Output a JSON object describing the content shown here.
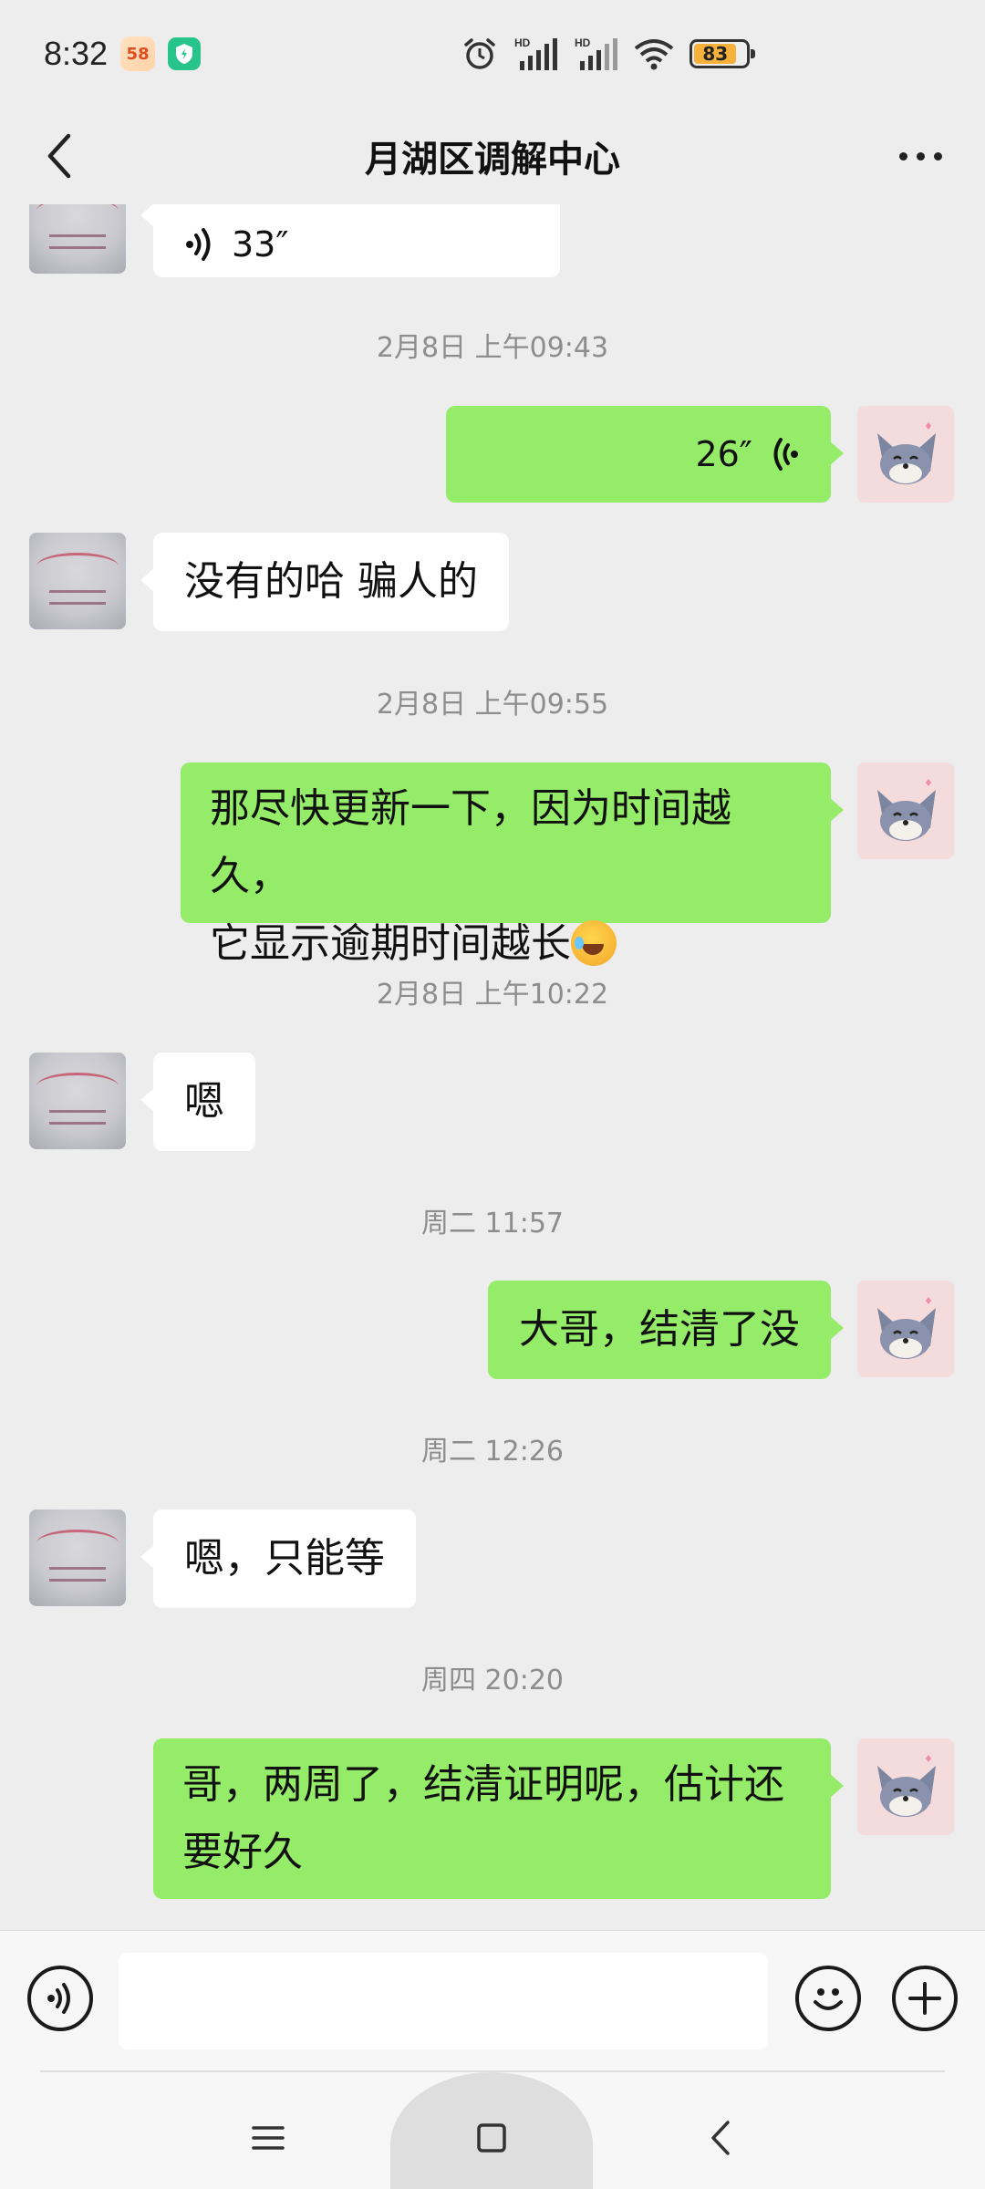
{
  "status_bar": {
    "time": "8:32",
    "app_badge_58": "58",
    "signal_1_label": "HD",
    "signal_2_label": "HD",
    "battery_level": "83"
  },
  "header": {
    "title": "月湖区调解中心"
  },
  "messages": [
    {
      "type": "voice",
      "direction": "in",
      "duration": "33″"
    },
    {
      "type": "timestamp",
      "text": "2月8日 上午09:43"
    },
    {
      "type": "voice",
      "direction": "out",
      "duration": "26″"
    },
    {
      "type": "text",
      "direction": "in",
      "text": "没有的哈 骗人的"
    },
    {
      "type": "timestamp",
      "text": "2月8日 上午09:55"
    },
    {
      "type": "text",
      "direction": "out",
      "line1": "那尽快更新一下，因为时间越久，",
      "line2": "它显示逾期时间越长"
    },
    {
      "type": "timestamp",
      "text": "2月8日 上午10:22"
    },
    {
      "type": "text",
      "direction": "in",
      "text": "嗯"
    },
    {
      "type": "timestamp",
      "text": "周二 11:57"
    },
    {
      "type": "text",
      "direction": "out",
      "text": "大哥，结清了没"
    },
    {
      "type": "timestamp",
      "text": "周二 12:26"
    },
    {
      "type": "text",
      "direction": "in",
      "text": "嗯，只能等"
    },
    {
      "type": "timestamp",
      "text": "周四 20:20"
    },
    {
      "type": "text",
      "direction": "out",
      "line1": "哥，两周了，结清证明呢，估计还",
      "line2": "要好久"
    }
  ],
  "input_bar": {
    "voice_icon": "voice-toggle-icon",
    "emoji_icon": "smiley-icon",
    "plus_icon": "plus-icon",
    "message_value": ""
  },
  "colors": {
    "outgoing_bubble": "#95ec69",
    "incoming_bubble": "#ffffff",
    "background": "#ededed",
    "timestamp_text": "#8d8d8d"
  }
}
